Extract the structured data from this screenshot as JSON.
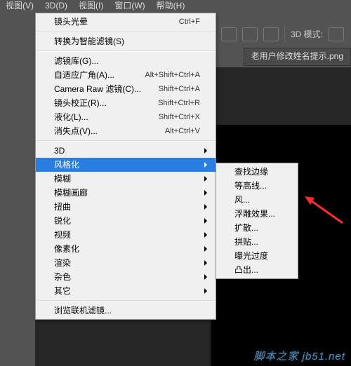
{
  "menubar": [
    "视图(V)",
    "3D(D)",
    "视图(I)",
    "窗口(W)",
    "帮助(H)"
  ],
  "toolbar": {
    "mode_label": "3D 模式:"
  },
  "tab": {
    "label": "老用户修改姓名提示.png"
  },
  "main_menu": {
    "grp1": [
      {
        "label": "镜头光晕",
        "shortcut": "Ctrl+F"
      }
    ],
    "grp2": [
      {
        "label": "转换为智能滤镜(S)"
      }
    ],
    "grp3": [
      {
        "label": "滤镜库(G)..."
      },
      {
        "label": "自适应广角(A)...",
        "shortcut": "Alt+Shift+Ctrl+A"
      },
      {
        "label": "Camera Raw 滤镜(C)...",
        "shortcut": "Shift+Ctrl+A"
      },
      {
        "label": "镜头校正(R)...",
        "shortcut": "Shift+Ctrl+R"
      },
      {
        "label": "液化(L)...",
        "shortcut": "Shift+Ctrl+X"
      },
      {
        "label": "消失点(V)...",
        "shortcut": "Alt+Ctrl+V"
      }
    ],
    "grp4": [
      {
        "label": "3D"
      },
      {
        "label": "风格化",
        "hl": true
      },
      {
        "label": "模糊"
      },
      {
        "label": "模糊画廊"
      },
      {
        "label": "扭曲"
      },
      {
        "label": "锐化"
      },
      {
        "label": "视频"
      },
      {
        "label": "像素化"
      },
      {
        "label": "渲染"
      },
      {
        "label": "杂色"
      },
      {
        "label": "其它"
      }
    ],
    "grp5": [
      {
        "label": "浏览联机滤镜..."
      }
    ]
  },
  "sub_menu": [
    {
      "label": "查找边缘"
    },
    {
      "label": "等高线..."
    },
    {
      "label": "风..."
    },
    {
      "label": "浮雕效果..."
    },
    {
      "label": "扩散..."
    },
    {
      "label": "拼贴..."
    },
    {
      "label": "曝光过度"
    },
    {
      "label": "凸出..."
    }
  ],
  "watermark": "脚本之家 jb51.net"
}
